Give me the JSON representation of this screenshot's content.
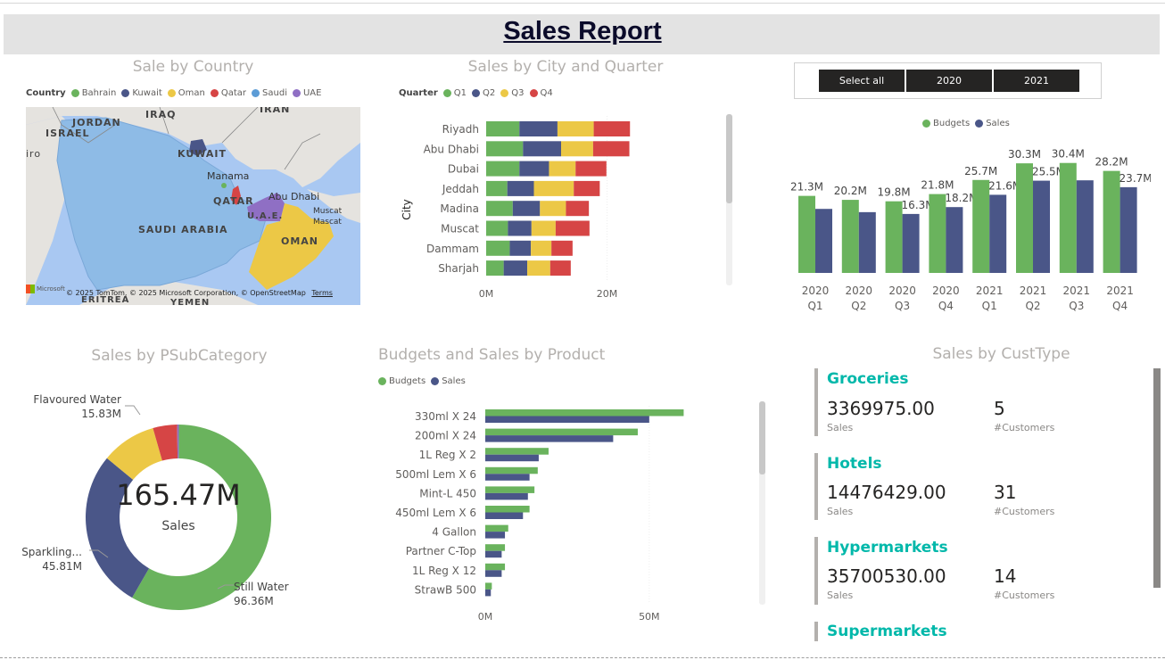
{
  "report": {
    "title": "Sales Report"
  },
  "country_map": {
    "title": "Sale by Country",
    "legend_title": "Country",
    "legend": [
      {
        "name": "Bahrain",
        "color": "#6ab35d"
      },
      {
        "name": "Kuwait",
        "color": "#4a5688"
      },
      {
        "name": "Oman",
        "color": "#ecc846"
      },
      {
        "name": "Qatar",
        "color": "#d64545"
      },
      {
        "name": "Saudi",
        "color": "#5c9cd6"
      },
      {
        "name": "UAE",
        "color": "#8f6fc4"
      }
    ],
    "labels": {
      "jordan": "JORDAN",
      "iraq": "IRAQ",
      "iran": "IRAN",
      "israel": "ISRAEL",
      "kuwait": "KUWAIT",
      "manama": "Manama",
      "qatar": "QATAR",
      "uae": "U.A.E.",
      "abu_dhabi": "Abu Dhabi",
      "muscat": "Muscat",
      "mascat": "Mascat",
      "saudi": "SAUDI ARABIA",
      "oman": "OMAN",
      "eritrea": "ERITREA",
      "yemen": "YEMEN",
      "cairo": "iro"
    },
    "attribution": "© 2025 TomTom, © 2025 Microsoft Corporation, © OpenStreetMap",
    "terms": "Terms",
    "logo": "Microsoft"
  },
  "city_chart": {
    "title": "Sales by City and Quarter",
    "legend_title": "Quarter",
    "ylabel": "City",
    "ticks": [
      "0M",
      "20M"
    ],
    "chart_data": {
      "type": "bar",
      "orientation": "horizontal",
      "stacked": true,
      "categories": [
        "Riyadh",
        "Abu Dhabi",
        "Dubai",
        "Jeddah",
        "Madina",
        "Muscat",
        "Dammam",
        "Sharjah"
      ],
      "series": [
        {
          "name": "Q1",
          "color": "#6ab35d",
          "values": [
            5.5,
            6.1,
            5.5,
            3.5,
            4.4,
            3.6,
            3.9,
            2.9
          ]
        },
        {
          "name": "Q2",
          "color": "#4a5688",
          "values": [
            6.3,
            6.3,
            4.9,
            4.4,
            4.5,
            3.9,
            3.5,
            3.9
          ]
        },
        {
          "name": "Q3",
          "color": "#ecc846",
          "values": [
            6.0,
            5.3,
            4.4,
            6.6,
            4.3,
            4.0,
            3.4,
            3.8
          ]
        },
        {
          "name": "Q4",
          "color": "#d64545",
          "values": [
            6.0,
            6.0,
            5.1,
            4.3,
            3.8,
            5.6,
            3.5,
            3.4
          ]
        }
      ],
      "xlim": [
        0,
        31
      ]
    }
  },
  "slicer": {
    "options": [
      "Select all",
      "2020",
      "2021"
    ]
  },
  "quarter_chart": {
    "legend": [
      {
        "name": "Budgets",
        "color": "#6ab35d"
      },
      {
        "name": "Sales",
        "color": "#4a5688"
      }
    ],
    "chart_data": {
      "type": "bar",
      "categories": [
        [
          "2020",
          "Q1"
        ],
        [
          "2020",
          "Q2"
        ],
        [
          "2020",
          "Q3"
        ],
        [
          "2020",
          "Q4"
        ],
        [
          "2021",
          "Q1"
        ],
        [
          "2021",
          "Q2"
        ],
        [
          "2021",
          "Q3"
        ],
        [
          "2021",
          "Q4"
        ]
      ],
      "series": [
        {
          "name": "Budgets",
          "color": "#6ab35d",
          "values": [
            21.3,
            20.2,
            19.8,
            21.8,
            25.7,
            30.3,
            30.4,
            28.2
          ],
          "labels": [
            "21.3M",
            "20.2M",
            "19.8M",
            "21.8M",
            "25.7M",
            "30.3M",
            "30.4M",
            "28.2M"
          ]
        },
        {
          "name": "Sales",
          "color": "#4a5688",
          "values": [
            17.7,
            16.8,
            16.3,
            18.2,
            21.6,
            25.5,
            25.6,
            23.7
          ],
          "labels": [
            "",
            "",
            "16.3M",
            "18.2M",
            "21.6M",
            "25.5M",
            "",
            "23.7M"
          ]
        }
      ],
      "ylim": [
        0,
        36
      ]
    }
  },
  "donut_chart": {
    "title": "Sales by PSubCategory",
    "center_value": "165.47M",
    "center_label": "Sales",
    "chart_data": {
      "type": "pie",
      "slices": [
        {
          "name": "Still Water",
          "value": 96.36,
          "label": "96.36M",
          "color": "#6ab35d"
        },
        {
          "name": "Sparkling...",
          "value": 45.81,
          "label": "45.81M",
          "color": "#4a5688"
        },
        {
          "name": "Flavoured Water",
          "value": 15.83,
          "label": "15.83M",
          "color": "#ecc846"
        },
        {
          "name": "",
          "value": 6.97,
          "label": "",
          "color": "#d64545"
        },
        {
          "name": "",
          "value": 0.5,
          "label": "",
          "color": "#8f6fc4"
        }
      ]
    }
  },
  "product_chart": {
    "title": "Budgets and Sales by Product",
    "legend": [
      {
        "name": "Budgets",
        "color": "#6ab35d"
      },
      {
        "name": "Sales",
        "color": "#4a5688"
      }
    ],
    "ticks": [
      "0M",
      "50M"
    ],
    "chart_data": {
      "type": "bar",
      "orientation": "horizontal",
      "categories": [
        "330ml X 24",
        "200ml X 24",
        "1L Reg X 2",
        "500ml Lem X 6",
        "Mint-L 450",
        "450ml Lem X 6",
        "4 Gallon",
        "Partner C-Top",
        "1L Reg X 12",
        "StrawB 500"
      ],
      "series": [
        {
          "name": "Budgets",
          "color": "#6ab35d",
          "values": [
            60.5,
            46.5,
            19.3,
            16.0,
            15.0,
            13.5,
            7.0,
            6.0,
            6.0,
            2.0
          ]
        },
        {
          "name": "Sales",
          "color": "#4a5688",
          "values": [
            50.0,
            39.0,
            16.3,
            13.5,
            13.0,
            11.5,
            6.0,
            5.0,
            5.0,
            1.7
          ]
        }
      ],
      "xlim": [
        0,
        68
      ]
    }
  },
  "custtype": {
    "title": "Sales by CustType",
    "cards": [
      {
        "category": "Groceries",
        "sales": "3369975.00",
        "sales_label": "Sales",
        "customers": "5",
        "customers_label": "#Customers"
      },
      {
        "category": "Hotels",
        "sales": "14476429.00",
        "sales_label": "Sales",
        "customers": "31",
        "customers_label": "#Customers"
      },
      {
        "category": "Hypermarkets",
        "sales": "35700530.00",
        "sales_label": "Sales",
        "customers": "14",
        "customers_label": "#Customers"
      },
      {
        "category": "Supermarkets"
      }
    ]
  }
}
